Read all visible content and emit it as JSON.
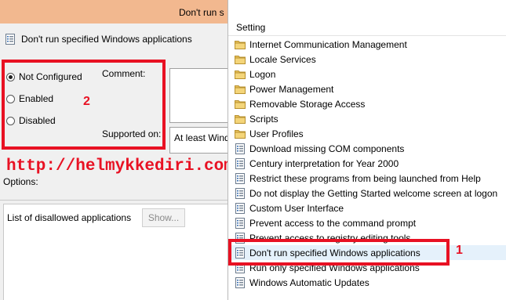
{
  "dialog": {
    "title": "Don't run s",
    "policy_name": "Don't run specified Windows applications",
    "states": [
      {
        "label": "Not Configured",
        "checked": true
      },
      {
        "label": "Enabled",
        "checked": false
      },
      {
        "label": "Disabled",
        "checked": false
      }
    ],
    "comment_label": "Comment:",
    "supported_label": "Supported on:",
    "supported_value": "At least Windo",
    "annotation_number": "2",
    "watermark": "http://helmykkediri.com/",
    "options_label": "Options:",
    "disallowed_label": "List of disallowed applications",
    "show_button": "Show..."
  },
  "settings": {
    "column_header": "Setting",
    "annotation_number": "1",
    "items": [
      {
        "label": "Internet Communication Management",
        "icon": "folder-icon"
      },
      {
        "label": "Locale Services",
        "icon": "folder-icon"
      },
      {
        "label": "Logon",
        "icon": "folder-icon"
      },
      {
        "label": "Power Management",
        "icon": "folder-icon"
      },
      {
        "label": "Removable Storage Access",
        "icon": "folder-icon"
      },
      {
        "label": "Scripts",
        "icon": "folder-icon"
      },
      {
        "label": "User Profiles",
        "icon": "folder-icon"
      },
      {
        "label": "Download missing COM components",
        "icon": "policy-setting-icon"
      },
      {
        "label": "Century interpretation for Year 2000",
        "icon": "policy-setting-icon"
      },
      {
        "label": "Restrict these programs from being launched from Help",
        "icon": "policy-setting-icon"
      },
      {
        "label": "Do not display the Getting Started welcome screen at logon",
        "icon": "policy-setting-icon"
      },
      {
        "label": "Custom User Interface",
        "icon": "policy-setting-icon"
      },
      {
        "label": "Prevent access to the command prompt",
        "icon": "policy-setting-icon"
      },
      {
        "label": "Prevent access to registry editing tools",
        "icon": "policy-setting-icon"
      },
      {
        "label": "Don't run specified Windows applications",
        "icon": "policy-setting-icon",
        "selected": true
      },
      {
        "label": "Run only specified Windows applications",
        "icon": "policy-setting-icon"
      },
      {
        "label": "Windows Automatic Updates",
        "icon": "policy-setting-icon"
      }
    ]
  },
  "colors": {
    "annotation_red": "#e81123",
    "titlebar": "#f2b88f",
    "folder": "#e8c15a",
    "selection": "#e5f1fb"
  }
}
